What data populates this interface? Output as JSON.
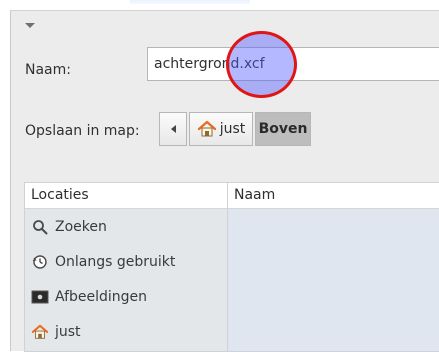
{
  "dialog": {
    "name_label": "Naam:",
    "filename_value": "achtergrond.xcf",
    "save_in_label": "Opslaan in map:",
    "path": {
      "home_label": "just",
      "current_label": "Boven"
    }
  },
  "places": {
    "header": "Locaties",
    "items": [
      {
        "label": "Zoeken",
        "icon": "search-icon"
      },
      {
        "label": "Onlangs gebruikt",
        "icon": "recent-icon"
      },
      {
        "label": "Afbeeldingen",
        "icon": "pictures-icon"
      },
      {
        "label": "just",
        "icon": "home-icon"
      }
    ]
  },
  "files": {
    "header": "Naam"
  },
  "colors": {
    "cursor_highlight_fill": "#505aff",
    "cursor_highlight_ring": "#e01616",
    "home_icon_orange": "#e86a1a"
  }
}
